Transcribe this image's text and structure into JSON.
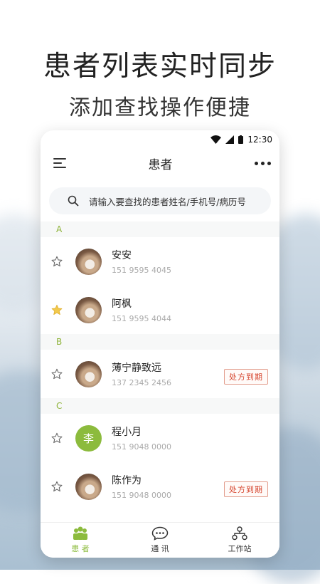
{
  "promo": {
    "headline": "患者列表实时同步",
    "subline": "添加查找操作便捷"
  },
  "status_bar": {
    "time": "12:30"
  },
  "nav": {
    "title": "患者"
  },
  "search": {
    "placeholder": "请输入要查找的患者姓名/手机号/病历号"
  },
  "sections": [
    {
      "letter": "A",
      "patients": [
        {
          "name": "安安",
          "phone": "151 9595 4045",
          "starred": false
        },
        {
          "name": "阿枫",
          "phone": "151 9595 4044",
          "starred": true
        }
      ]
    },
    {
      "letter": "B",
      "patients": [
        {
          "name": "薄宁静致远",
          "phone": "137 2345 2456",
          "starred": false,
          "badge": "处方到期"
        }
      ]
    },
    {
      "letter": "C",
      "patients": [
        {
          "name": "程小月",
          "phone": "151 9048 0000",
          "starred": false,
          "avatar_letter": "李"
        },
        {
          "name": "陈作为",
          "phone": "151 9048 0000",
          "starred": false,
          "badge": "处方到期"
        }
      ]
    }
  ],
  "tabs": [
    {
      "label": "患 者",
      "icon": "patients-icon",
      "active": true
    },
    {
      "label": "通 讯",
      "icon": "chat-icon",
      "active": false
    },
    {
      "label": "工作站",
      "icon": "workstation-icon",
      "active": false
    }
  ],
  "colors": {
    "accent": "#8cbb3d",
    "badge": "#d6452e",
    "star_active": "#f2c94c"
  }
}
